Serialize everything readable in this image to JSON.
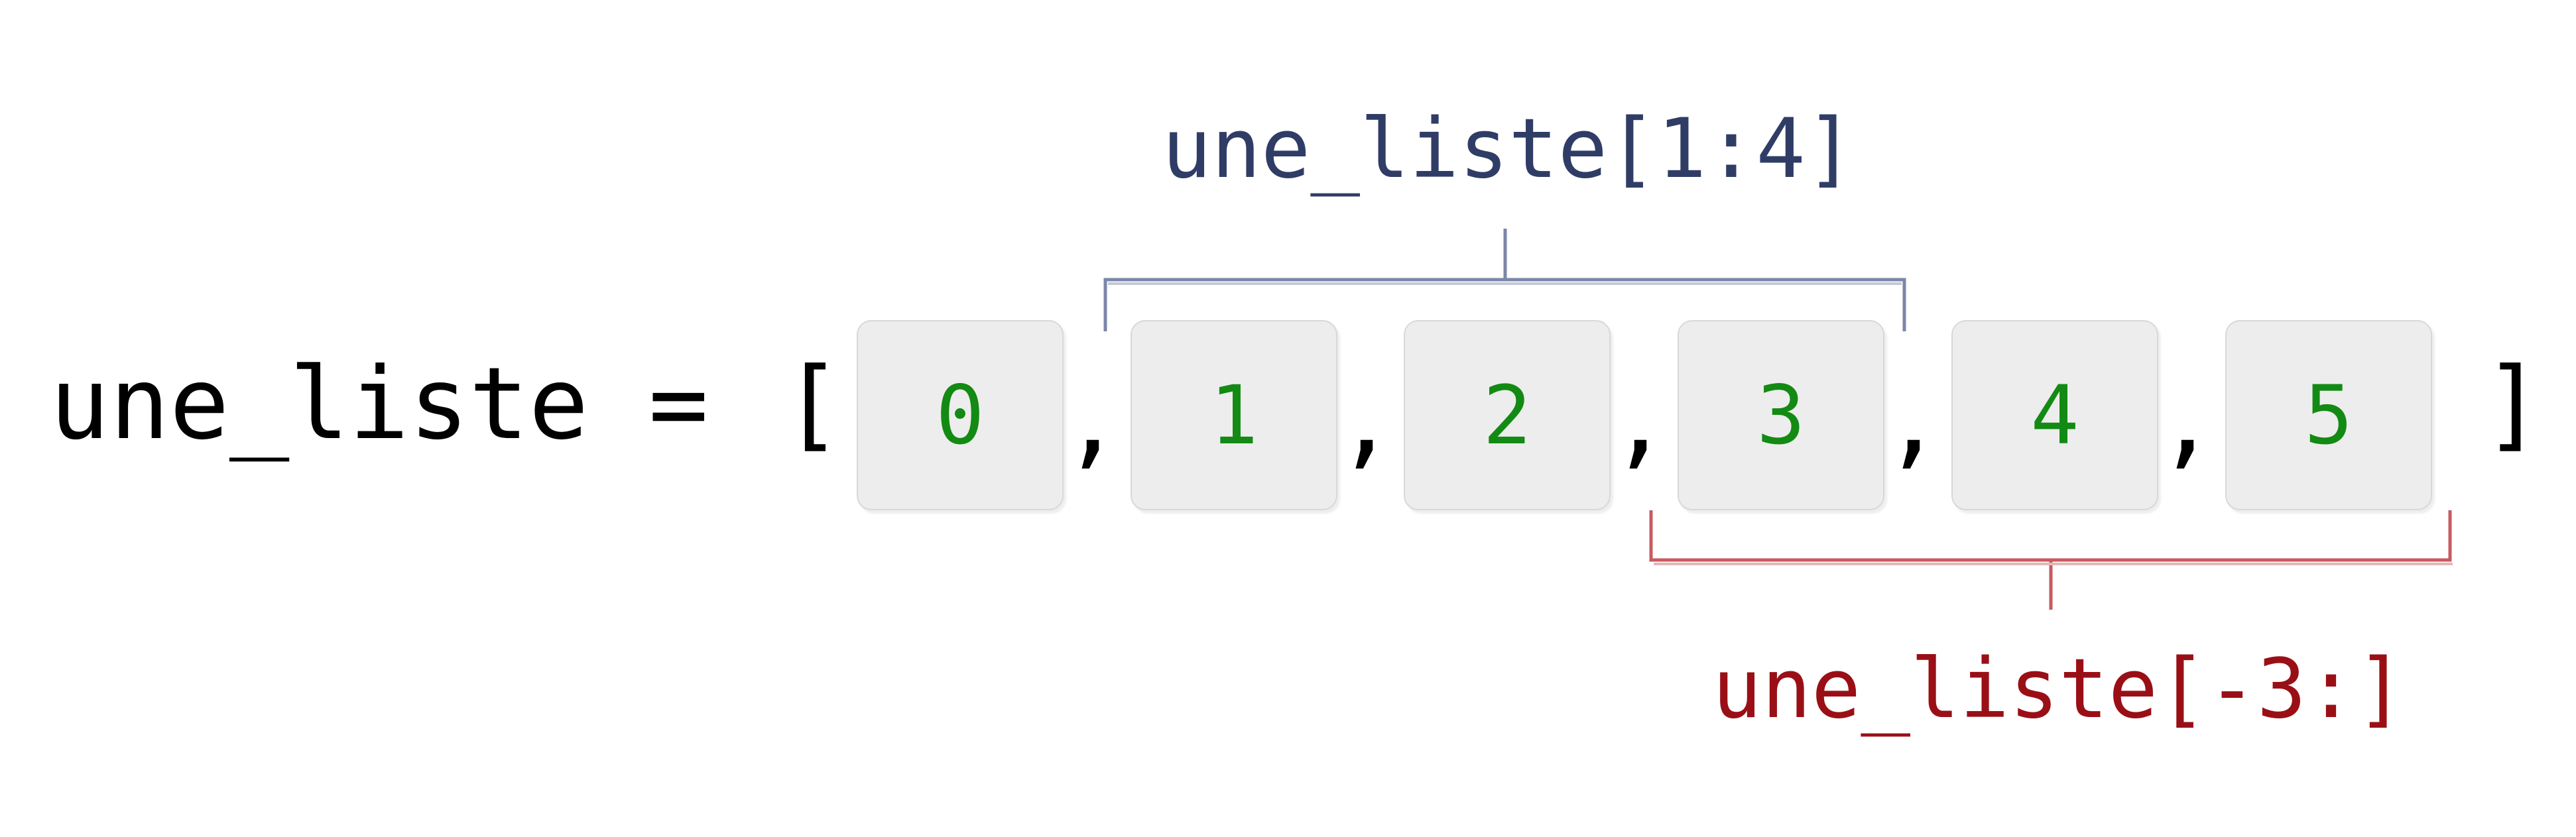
{
  "expression": {
    "variable": "une_liste",
    "operator": "=",
    "open_bracket": "[",
    "close_bracket": "]",
    "separator": ","
  },
  "elements": [
    "0",
    "1",
    "2",
    "3",
    "4",
    "5"
  ],
  "slices": [
    {
      "label": "une_liste[1:4]",
      "start_index": 1,
      "end_index": 3,
      "position": "above",
      "color": "#2f3d66",
      "bracket_color": "#7b86a8"
    },
    {
      "label": "une_liste[-3:]",
      "start_index": 3,
      "end_index": 5,
      "position": "below",
      "color": "#9a0f16",
      "bracket_color": "#c85a5f"
    }
  ],
  "colors": {
    "element_text": "#138a13",
    "element_fill": "#ededed",
    "code_text": "#000000"
  }
}
